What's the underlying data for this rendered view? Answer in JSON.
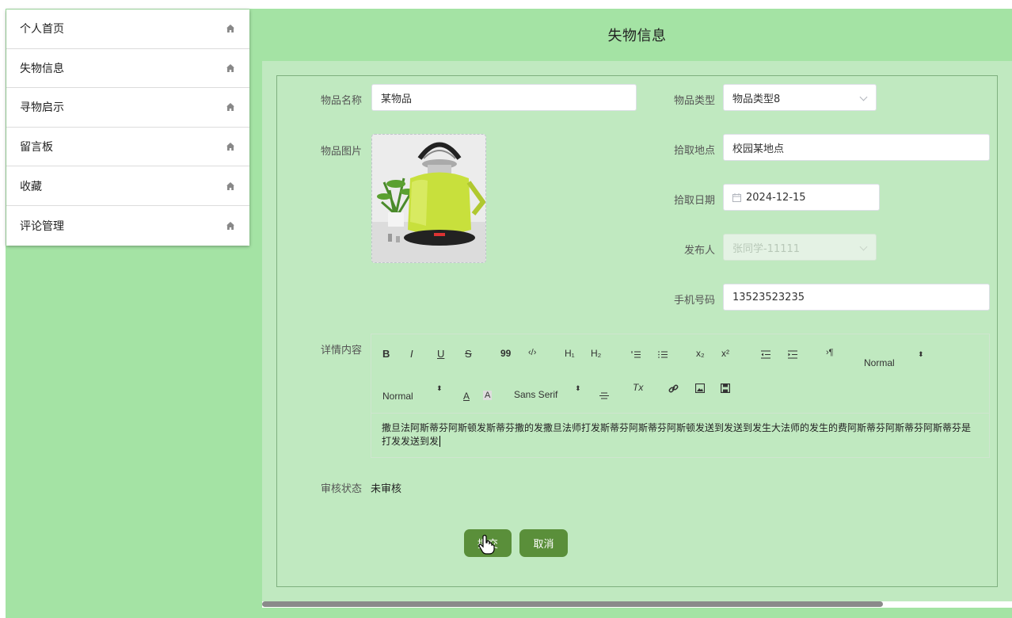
{
  "sidebar": {
    "items": [
      {
        "label": "个人首页",
        "icon": "home-icon"
      },
      {
        "label": "失物信息",
        "icon": "home-icon"
      },
      {
        "label": "寻物启示",
        "icon": "home-icon"
      },
      {
        "label": "留言板",
        "icon": "home-icon"
      },
      {
        "label": "收藏",
        "icon": "home-icon"
      },
      {
        "label": "评论管理",
        "icon": "home-icon"
      }
    ]
  },
  "header": {
    "title": "失物信息"
  },
  "form": {
    "item_name_label": "物品名称",
    "item_name_value": "某物品",
    "item_type_label": "物品类型",
    "item_type_value": "物品类型8",
    "item_image_label": "物品图片",
    "pickup_place_label": "拾取地点",
    "pickup_place_value": "校园某地点",
    "pickup_date_label": "拾取日期",
    "pickup_date_value": "2024-12-15",
    "publisher_label": "发布人",
    "publisher_value": "张同学-11111",
    "phone_label": "手机号码",
    "phone_value": "13523523235",
    "detail_label": "详情内容",
    "review_status_label": "审核状态",
    "review_status_value": "未审核"
  },
  "editor": {
    "toolbar": {
      "bold": "B",
      "italic": "I",
      "underline": "U",
      "strike": "S",
      "blockquote": "99",
      "code": "‹/›",
      "h1": "H₁",
      "h2": "H₂",
      "superscript_icon": "x²",
      "subscript_icon": "x₂",
      "direction": "›¶",
      "size_select": "Normal",
      "header_select": "Normal",
      "font_select": "Sans Serif",
      "color_a": "A",
      "bg_a": "A",
      "clean": "Tx"
    },
    "content": "撒旦法阿斯蒂芬阿斯顿发斯蒂芬撒的发撒旦法师打发斯蒂芬阿斯蒂芬阿斯顿发送到发送到发生大法师的发生的费阿斯蒂芬阿斯蒂芬阿斯蒂芬是打发发送到发"
  },
  "buttons": {
    "submit": "提交",
    "cancel": "取消"
  },
  "colors": {
    "app_bg": "#a4e3a4",
    "panel_bg": "#c0e9c0",
    "button_bg": "#5a8f3a",
    "kettle_body": "#c8e03c"
  }
}
